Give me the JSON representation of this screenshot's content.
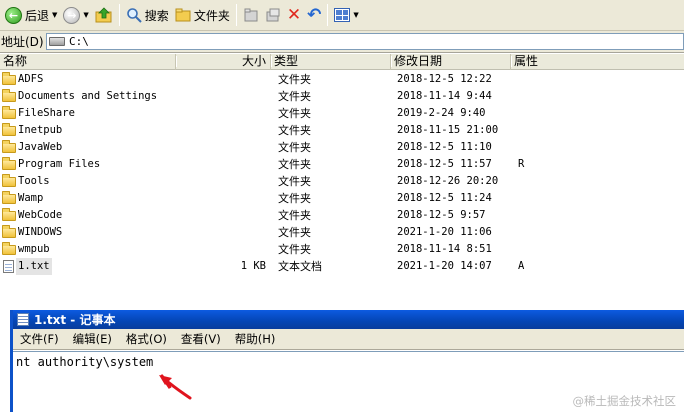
{
  "toolbar": {
    "back_label": "后退",
    "search_label": "搜索",
    "folders_label": "文件夹"
  },
  "address": {
    "label": "地址(D)",
    "value": "C:\\"
  },
  "columns": {
    "name": "名称",
    "size": "大小",
    "type": "类型",
    "modified": "修改日期",
    "attributes": "属性"
  },
  "files": [
    {
      "name": "ADFS",
      "size": "",
      "type": "文件夹",
      "modified": "2018-12-5 12:22",
      "attr": ""
    },
    {
      "name": "Documents and Settings",
      "size": "",
      "type": "文件夹",
      "modified": "2018-11-14 9:44",
      "attr": ""
    },
    {
      "name": "FileShare",
      "size": "",
      "type": "文件夹",
      "modified": "2019-2-24 9:40",
      "attr": ""
    },
    {
      "name": "Inetpub",
      "size": "",
      "type": "文件夹",
      "modified": "2018-11-15 21:00",
      "attr": ""
    },
    {
      "name": "JavaWeb",
      "size": "",
      "type": "文件夹",
      "modified": "2018-12-5 11:10",
      "attr": ""
    },
    {
      "name": "Program Files",
      "size": "",
      "type": "文件夹",
      "modified": "2018-12-5 11:57",
      "attr": "R"
    },
    {
      "name": "Tools",
      "size": "",
      "type": "文件夹",
      "modified": "2018-12-26 20:20",
      "attr": ""
    },
    {
      "name": "Wamp",
      "size": "",
      "type": "文件夹",
      "modified": "2018-12-5 11:24",
      "attr": ""
    },
    {
      "name": "WebCode",
      "size": "",
      "type": "文件夹",
      "modified": "2018-12-5 9:57",
      "attr": ""
    },
    {
      "name": "WINDOWS",
      "size": "",
      "type": "文件夹",
      "modified": "2021-1-20 11:06",
      "attr": ""
    },
    {
      "name": "wmpub",
      "size": "",
      "type": "文件夹",
      "modified": "2018-11-14 8:51",
      "attr": ""
    },
    {
      "name": "1.txt",
      "size": "1 KB",
      "type": "文本文档",
      "modified": "2021-1-20 14:07",
      "attr": "A"
    }
  ],
  "notepad": {
    "title": "1.txt - 记事本",
    "menu": [
      "文件(F)",
      "编辑(E)",
      "格式(O)",
      "查看(V)",
      "帮助(H)"
    ],
    "content": "nt authority\\system"
  },
  "watermark": "@稀土掘金技术社区",
  "colors": {
    "titlebar": "#0a4fc8",
    "chrome": "#ece9d8",
    "arrow": "#e0141e"
  }
}
